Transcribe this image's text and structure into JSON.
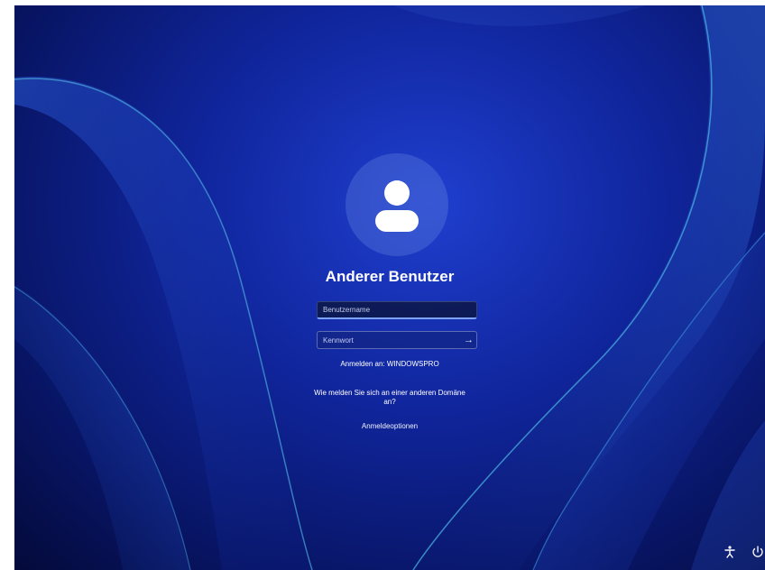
{
  "login": {
    "user_name": "Anderer Benutzer",
    "username_placeholder": "Benutzername",
    "password_placeholder": "Kennwort",
    "submit_icon": "arrow-right-icon",
    "sign_in_to": "Anmelden an: WINDOWSPRO",
    "other_domain_link": "Wie melden Sie sich an einer anderen Domäne an?",
    "sign_in_options": "Anmeldeoptionen"
  },
  "avatar_icon": "user-icon",
  "tray": {
    "accessibility_icon": "accessibility-icon",
    "power_icon": "power-icon"
  },
  "colors": {
    "background_dark": "#040a3a",
    "background_mid": "#10259c",
    "ribbon": "#3b8fd8",
    "input_focus": "#7da3ff"
  }
}
